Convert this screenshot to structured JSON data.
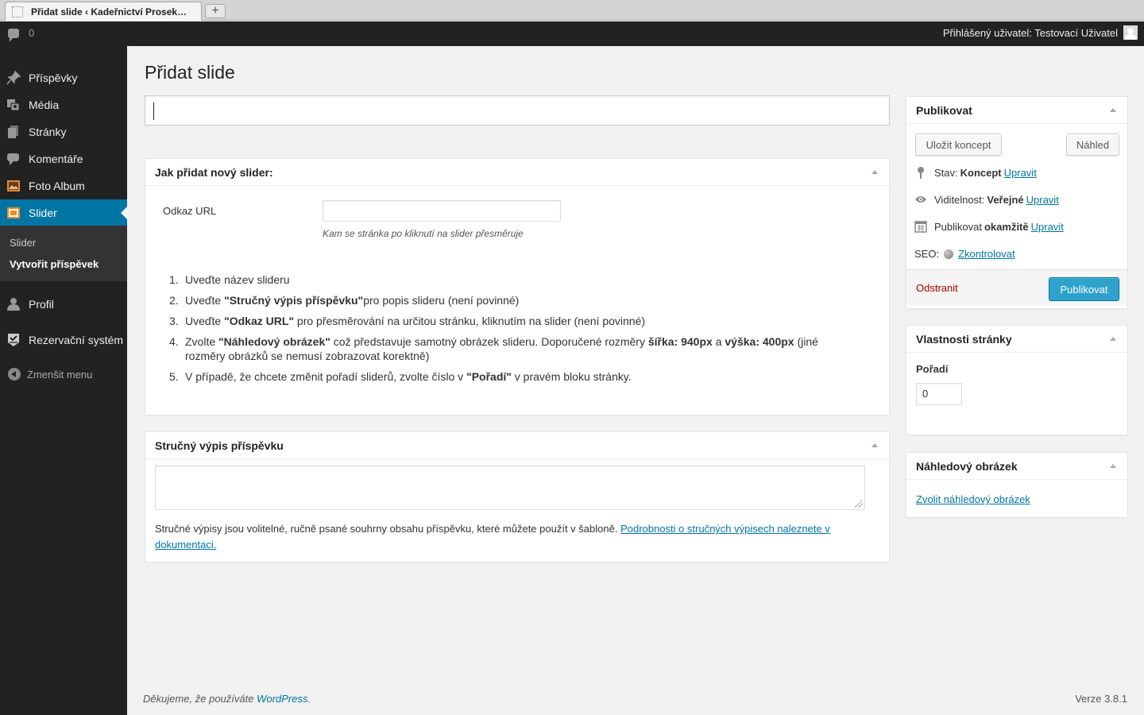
{
  "browser": {
    "tab_title": "Přidat slide ‹ Kadeřnictví Prosek…",
    "new_tab": "+"
  },
  "adminbar": {
    "comments_count": "0",
    "user_greeting": "Přihlášený uživatel: Testovací Uživatel"
  },
  "sidebar": {
    "items": [
      {
        "label": "Příspěvky",
        "icon": "pin-icon"
      },
      {
        "label": "Média",
        "icon": "media-icon"
      },
      {
        "label": "Stránky",
        "icon": "pages-icon"
      },
      {
        "label": "Komentáře",
        "icon": "comment-icon"
      },
      {
        "label": "Foto Album",
        "icon": "photo-album-icon"
      },
      {
        "label": "Slider",
        "icon": "slider-icon"
      },
      {
        "label": "Profil",
        "icon": "user-icon"
      },
      {
        "label": "Rezervační systém",
        "icon": "reservation-icon"
      }
    ],
    "submenu": [
      "Slider",
      "Vytvořit příspěvek"
    ],
    "collapse_label": "Zmenšit menu"
  },
  "main": {
    "page_title": "Přidat slide",
    "title_input_value": "",
    "howto_box": {
      "title": "Jak přidat nový slider:",
      "url_label": "Odkaz URL",
      "url_value": "",
      "url_description": "Kam se stránka po kliknutí na slider přesměruje",
      "steps": [
        {
          "num": "1.",
          "text": "Uveďte název slideru"
        },
        {
          "num": "2.",
          "pre": "Uveďte ",
          "bold": "\"Stručný výpis příspěvku\"",
          "post": "pro popis slideru (není povinné)"
        },
        {
          "num": "3.",
          "pre": "Uveďte ",
          "bold": "\"Odkaz URL\"",
          "post": " pro přesměrování na určitou stránku, kliknutím na slider (není povinné)"
        },
        {
          "num": "4.",
          "pre": "Zvolte ",
          "bold": "\"Náhledový obrázek\"",
          "mid1": " což představuje samotný obrázek slideru. Doporučené rozměry ",
          "bold2": "šířka: 940px",
          "mid2": " a ",
          "bold3": "výška: 400px",
          "post": " (jiné rozměry obrázků se nemusí zobrazovat korektně)"
        },
        {
          "num": "5.",
          "pre": "V případě, že chcete změnit pořadí sliderů, zvolte číslo v ",
          "bold": "\"Pořadí\"",
          "post": " v pravém bloku stránky."
        }
      ]
    },
    "excerpt_box": {
      "title": "Stručný výpis příspěvku",
      "value": "",
      "help_text": "Stručné výpisy jsou volitelné, ručně psané souhrny obsahu příspěvku, které můžete použít v šabloně. ",
      "help_link": "Podrobnosti o stručných výpisech naleznete v dokumentaci."
    }
  },
  "publish_box": {
    "title": "Publikovat",
    "save_draft": "Uložit koncept",
    "preview": "Náhled",
    "status_label": "Stav:",
    "status_value": "Koncept",
    "visibility_label": "Viditelnost:",
    "visibility_value": "Veřejné",
    "publish_label": "Publikovat",
    "publish_value": "okamžitě",
    "edit_link": "Upravit",
    "seo_label": "SEO:",
    "seo_link": "Zkontrolovat",
    "delete": "Odstranit",
    "publish_button": "Publikovat"
  },
  "page_attributes": {
    "title": "Vlastnosti stránky",
    "order_label": "Pořadí",
    "order_value": "0"
  },
  "featured_image": {
    "title": "Náhledový obrázek",
    "link": "Zvolit náhledový obrázek"
  },
  "footer": {
    "thanks_pre": "Děkujeme, že používáte ",
    "thanks_link": "WordPress",
    "thanks_post": ".",
    "version": "Verze 3.8.1"
  },
  "colors": {
    "sidebar_bg": "#222222",
    "active_menu": "#0074a2",
    "primary_button": "#2ea2cc",
    "link": "#0074a2",
    "delete": "#aa0000"
  }
}
